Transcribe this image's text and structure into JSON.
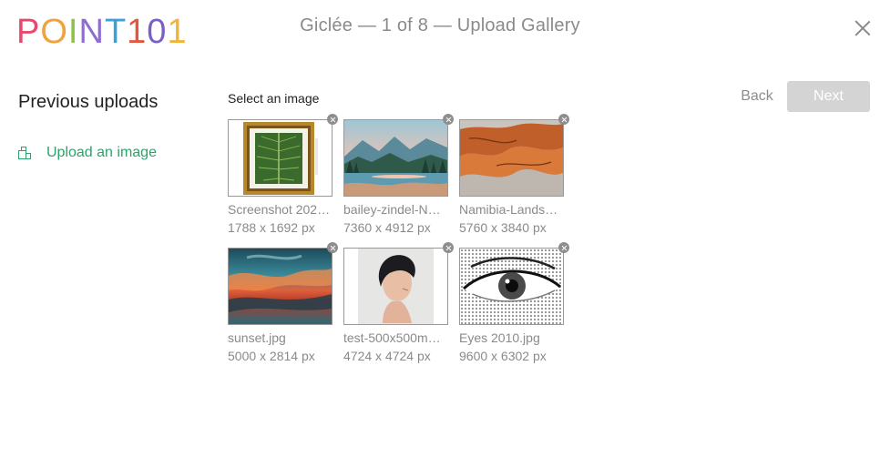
{
  "brand": {
    "logo_letters": [
      {
        "char": "P",
        "color": "#e8486b"
      },
      {
        "char": "O",
        "color": "#f2a23a"
      },
      {
        "char": "I",
        "color": "#8bc34a"
      },
      {
        "char": "N",
        "color": "#8e6fd1"
      },
      {
        "char": "T",
        "color": "#3aa0d8"
      },
      {
        "char": "1",
        "color": "#e2583e"
      },
      {
        "char": "0",
        "color": "#7a5fc9"
      },
      {
        "char": "1",
        "color": "#f0b43a"
      }
    ]
  },
  "header": {
    "title": "Giclée — 1 of 8 — Upload Gallery",
    "close_icon": "close-icon"
  },
  "sidebar": {
    "title": "Previous uploads",
    "upload_label": "Upload an image",
    "upload_icon": "image-stack-icon",
    "accent": "#2aa46b"
  },
  "main": {
    "select_label": "Select an image",
    "back_label": "Back",
    "next_label": "Next",
    "images": [
      {
        "name": "Screenshot 202…",
        "dims": "1788 x 1692 px",
        "art": "framed-leaf"
      },
      {
        "name": "bailey-zindel-N…",
        "dims": "7360 x 4912 px",
        "art": "mountain-lake"
      },
      {
        "name": "Namibia-Landsc…",
        "dims": "5760 x 3840 px",
        "art": "desert-dunes"
      },
      {
        "name": "sunset.jpg",
        "dims": "5000 x 2814 px",
        "art": "sunset-painting"
      },
      {
        "name": "test-500x500m…",
        "dims": "4724 x 4724 px",
        "art": "portrait"
      },
      {
        "name": "Eyes 2010.jpg",
        "dims": "9600 x 6302 px",
        "art": "halftone-eye"
      }
    ]
  }
}
